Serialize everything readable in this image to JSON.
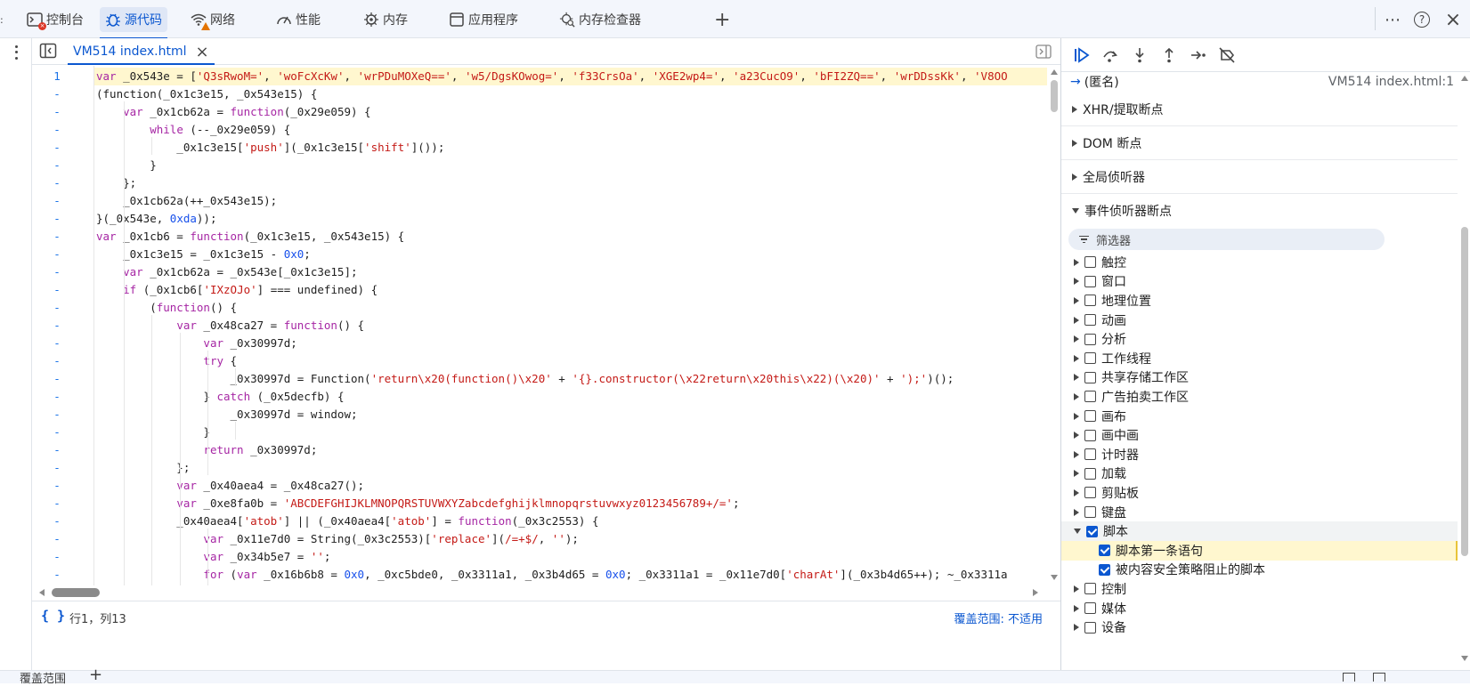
{
  "tabs": [
    {
      "label": "控制台",
      "icon": "console-icon"
    },
    {
      "label": "源代码",
      "icon": "bug-icon"
    },
    {
      "label": "网络",
      "icon": "wifi-icon"
    },
    {
      "label": "性能",
      "icon": "gauge-icon"
    },
    {
      "label": "内存",
      "icon": "memory-chip-icon"
    },
    {
      "label": "应用程序",
      "icon": "app-window-icon"
    },
    {
      "label": "内存检查器",
      "icon": "memory-inspector-icon"
    }
  ],
  "top_right": {
    "more": "⋯",
    "help": "?",
    "close": "×"
  },
  "file_tab": {
    "label": "VM514 index.html"
  },
  "gutter_first": "1",
  "gutter_other": "-",
  "code_lines": [
    [
      [
        "kw",
        "var"
      ],
      [
        "p",
        " _0x543e = ["
      ],
      [
        "str",
        "'Q3sRwoM='"
      ],
      [
        "p",
        ", "
      ],
      [
        "str",
        "'woFcXcKw'"
      ],
      [
        "p",
        ", "
      ],
      [
        "str",
        "'wrPDuMOXeQ=='"
      ],
      [
        "p",
        ", "
      ],
      [
        "str",
        "'w5/DgsKOwog='"
      ],
      [
        "p",
        ", "
      ],
      [
        "str",
        "'f33CrsOa'"
      ],
      [
        "p",
        ", "
      ],
      [
        "str",
        "'XGE2wp4='"
      ],
      [
        "p",
        ", "
      ],
      [
        "str",
        "'a23CucO9'"
      ],
      [
        "p",
        ", "
      ],
      [
        "str",
        "'bFI2ZQ=='"
      ],
      [
        "p",
        ", "
      ],
      [
        "str",
        "'wrDDssKk'"
      ],
      [
        "p",
        ", "
      ],
      [
        "str",
        "'V8OO"
      ]
    ],
    [
      [
        "p",
        "(function(_0x1c3e15, _0x543e15) {"
      ]
    ],
    [
      [
        "p",
        "    "
      ],
      [
        "kw",
        "var"
      ],
      [
        "p",
        " _0x1cb62a = "
      ],
      [
        "kw",
        "function"
      ],
      [
        "p",
        "(_0x29e059) {"
      ]
    ],
    [
      [
        "p",
        "        "
      ],
      [
        "kw",
        "while"
      ],
      [
        "p",
        " (--_0x29e059) {"
      ]
    ],
    [
      [
        "p",
        "            _0x1c3e15["
      ],
      [
        "str",
        "'push'"
      ],
      [
        "p",
        "](_0x1c3e15["
      ],
      [
        "str",
        "'shift'"
      ],
      [
        "p",
        "]());"
      ]
    ],
    [
      [
        "p",
        "        }"
      ]
    ],
    [
      [
        "p",
        "    };"
      ]
    ],
    [
      [
        "p",
        "    _0x1cb62a(++_0x543e15);"
      ]
    ],
    [
      [
        "p",
        "}(_0x543e, "
      ],
      [
        "num",
        "0xda"
      ],
      [
        "p",
        "));"
      ]
    ],
    [
      [
        "kw",
        "var"
      ],
      [
        "p",
        " _0x1cb6 = "
      ],
      [
        "kw",
        "function"
      ],
      [
        "p",
        "(_0x1c3e15, _0x543e15) {"
      ]
    ],
    [
      [
        "p",
        "    _0x1c3e15 = _0x1c3e15 - "
      ],
      [
        "num",
        "0x0"
      ],
      [
        "p",
        ";"
      ]
    ],
    [
      [
        "p",
        "    "
      ],
      [
        "kw",
        "var"
      ],
      [
        "p",
        " _0x1cb62a = _0x543e[_0x1c3e15];"
      ]
    ],
    [
      [
        "p",
        "    "
      ],
      [
        "kw",
        "if"
      ],
      [
        "p",
        " (_0x1cb6["
      ],
      [
        "str",
        "'IXzOJo'"
      ],
      [
        "p",
        "] === undefined) {"
      ]
    ],
    [
      [
        "p",
        "        ("
      ],
      [
        "kw",
        "function"
      ],
      [
        "p",
        "() {"
      ]
    ],
    [
      [
        "p",
        "            "
      ],
      [
        "kw",
        "var"
      ],
      [
        "p",
        " _0x48ca27 = "
      ],
      [
        "kw",
        "function"
      ],
      [
        "p",
        "() {"
      ]
    ],
    [
      [
        "p",
        "                "
      ],
      [
        "kw",
        "var"
      ],
      [
        "p",
        " _0x30997d;"
      ]
    ],
    [
      [
        "p",
        "                "
      ],
      [
        "kw",
        "try"
      ],
      [
        "p",
        " {"
      ]
    ],
    [
      [
        "p",
        "                    _0x30997d = Function("
      ],
      [
        "str",
        "'return\\x20(function()\\x20'"
      ],
      [
        "p",
        " + "
      ],
      [
        "str",
        "'{}.constructor(\\x22return\\x20this\\x22)(\\x20)'"
      ],
      [
        "p",
        " + "
      ],
      [
        "str",
        "');'"
      ],
      [
        "p",
        ")();"
      ]
    ],
    [
      [
        "p",
        "                } "
      ],
      [
        "kw",
        "catch"
      ],
      [
        "p",
        " (_0x5decfb) {"
      ]
    ],
    [
      [
        "p",
        "                    _0x30997d = window;"
      ]
    ],
    [
      [
        "p",
        "                }"
      ]
    ],
    [
      [
        "p",
        "                "
      ],
      [
        "kw",
        "return"
      ],
      [
        "p",
        " _0x30997d;"
      ]
    ],
    [
      [
        "p",
        "            };"
      ]
    ],
    [
      [
        "p",
        "            "
      ],
      [
        "kw",
        "var"
      ],
      [
        "p",
        " _0x40aea4 = _0x48ca27();"
      ]
    ],
    [
      [
        "p",
        "            "
      ],
      [
        "kw",
        "var"
      ],
      [
        "p",
        " _0xe8fa0b = "
      ],
      [
        "str",
        "'ABCDEFGHIJKLMNOPQRSTUVWXYZabcdefghijklmnopqrstuvwxyz0123456789+/='"
      ],
      [
        "p",
        ";"
      ]
    ],
    [
      [
        "p",
        "            _0x40aea4["
      ],
      [
        "str",
        "'atob'"
      ],
      [
        "p",
        "] || (_0x40aea4["
      ],
      [
        "str",
        "'atob'"
      ],
      [
        "p",
        "] = "
      ],
      [
        "kw",
        "function"
      ],
      [
        "p",
        "(_0x3c2553) {"
      ]
    ],
    [
      [
        "p",
        "                "
      ],
      [
        "kw",
        "var"
      ],
      [
        "p",
        " _0x11e7d0 = String(_0x3c2553)["
      ],
      [
        "str",
        "'replace'"
      ],
      [
        "p",
        "]("
      ],
      [
        "str",
        "/=+$/"
      ],
      [
        "p",
        ", "
      ],
      [
        "str",
        "''"
      ],
      [
        "p",
        ");"
      ]
    ],
    [
      [
        "p",
        "                "
      ],
      [
        "kw",
        "var"
      ],
      [
        "p",
        " _0x34b5e7 = "
      ],
      [
        "str",
        "''"
      ],
      [
        "p",
        ";"
      ]
    ],
    [
      [
        "p",
        "                "
      ],
      [
        "kw",
        "for"
      ],
      [
        "p",
        " ("
      ],
      [
        "kw",
        "var"
      ],
      [
        "p",
        " _0x16b6b8 = "
      ],
      [
        "num",
        "0x0"
      ],
      [
        "p",
        ", _0xc5bde0, _0x3311a1, _0x3b4d65 = "
      ],
      [
        "num",
        "0x0"
      ],
      [
        "p",
        "; _0x3311a1 = _0x11e7d0["
      ],
      [
        "str",
        "'charAt'"
      ],
      [
        "p",
        "](_0x3b4d65++); ~_0x3311a"
      ]
    ]
  ],
  "status": {
    "position": "行1，列13",
    "coverage": "覆盖范围: 不适用",
    "format": "{ }"
  },
  "drawer": {
    "label": "覆盖范围",
    "add": "+"
  },
  "debugger": {
    "anonymous_label": "(匿名)",
    "anonymous_location": "VM514 index.html:1",
    "sections": [
      "XHR/提取断点",
      "DOM 断点",
      "全局侦听器",
      "事件侦听器断点"
    ],
    "filter_label": "筛选器",
    "event_categories": [
      {
        "label": "触控",
        "checked": false,
        "expanded": false
      },
      {
        "label": "窗口",
        "checked": false,
        "expanded": false
      },
      {
        "label": "地理位置",
        "checked": false,
        "expanded": false
      },
      {
        "label": "动画",
        "checked": false,
        "expanded": false
      },
      {
        "label": "分析",
        "checked": false,
        "expanded": false
      },
      {
        "label": "工作线程",
        "checked": false,
        "expanded": false
      },
      {
        "label": "共享存储工作区",
        "checked": false,
        "expanded": false
      },
      {
        "label": "广告拍卖工作区",
        "checked": false,
        "expanded": false
      },
      {
        "label": "画布",
        "checked": false,
        "expanded": false
      },
      {
        "label": "画中画",
        "checked": false,
        "expanded": false
      },
      {
        "label": "计时器",
        "checked": false,
        "expanded": false
      },
      {
        "label": "加载",
        "checked": false,
        "expanded": false
      },
      {
        "label": "剪贴板",
        "checked": false,
        "expanded": false
      },
      {
        "label": "键盘",
        "checked": false,
        "expanded": false
      },
      {
        "label": "脚本",
        "checked": true,
        "expanded": true
      },
      {
        "label": "控制",
        "checked": false,
        "expanded": false
      },
      {
        "label": "媒体",
        "checked": false,
        "expanded": false
      },
      {
        "label": "设备",
        "checked": false,
        "expanded": false
      }
    ],
    "script_children": [
      {
        "label": "脚本第一条语句",
        "checked": true
      },
      {
        "label": "被内容安全策略阻止的脚本",
        "checked": true
      }
    ]
  },
  "colors": {
    "accent": "#0b57d0",
    "keyword": "#a626a4",
    "string": "#c41a16",
    "number": "#1750eb",
    "highlight": "#fff7cf"
  }
}
